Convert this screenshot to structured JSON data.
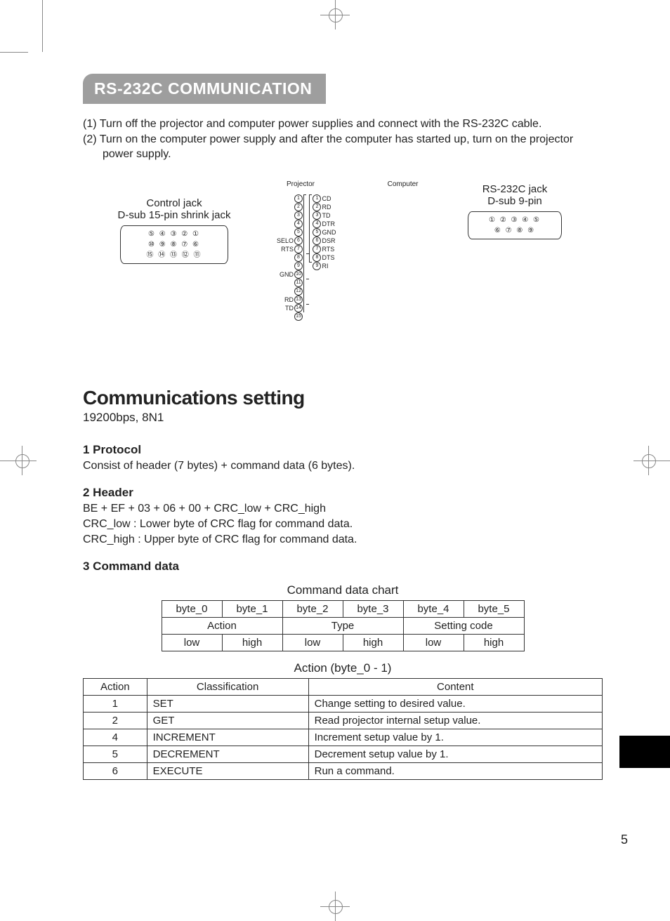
{
  "page_number": "5",
  "title": "RS-232C COMMUNICATION",
  "intro": {
    "line1": "(1) Turn off the projector and computer power supplies and connect with the RS-232C cable.",
    "line2": "(2) Turn on the computer power supply and after the computer has started up, turn on the projector power supply."
  },
  "diagrams": {
    "control": {
      "label1": "Control jack",
      "label2": "D-sub 15-pin shrink jack"
    },
    "projector_label": "Projector",
    "computer_label": "Computer",
    "rs232c": {
      "label1": "RS-232C jack",
      "label2": "D-sub 9-pin"
    },
    "projector_pins": [
      "1",
      "2",
      "3",
      "4",
      "5",
      "6",
      "7",
      "8",
      "9",
      "10",
      "11",
      "12",
      "13",
      "14",
      "15"
    ],
    "projector_signals": {
      "6": "SELO",
      "7": "RTS",
      "10": "GND",
      "13": "RD",
      "14": "TD"
    },
    "computer_pins": [
      "1",
      "2",
      "3",
      "4",
      "5",
      "6",
      "7",
      "8",
      "9"
    ],
    "computer_signals": {
      "1": "CD",
      "2": "RD",
      "3": "TD",
      "4": "DTR",
      "5": "GND",
      "6": "DSR",
      "7": "RTS",
      "8": "DTS",
      "9": "RI"
    }
  },
  "comm": {
    "heading": "Communications setting",
    "sub": "19200bps,  8N1",
    "s1h": "1 Protocol",
    "s1b": "Consist of header (7 bytes) + command data (6 bytes).",
    "s2h": "2 Header",
    "s2b1": "BE + EF + 03 + 06 + 00 + CRC_low + CRC_high",
    "s2b2": "CRC_low : Lower byte of CRC flag for command data.",
    "s2b3": "CRC_high : Upper byte of CRC flag for command data.",
    "s3h": "3 Command data"
  },
  "cmd_chart": {
    "title": "Command data chart",
    "h": [
      "byte_0",
      "byte_1",
      "byte_2",
      "byte_3",
      "byte_4",
      "byte_5"
    ],
    "g": [
      "Action",
      "Type",
      "Setting code"
    ],
    "lh": [
      "low",
      "high",
      "low",
      "high",
      "low",
      "high"
    ]
  },
  "action_table": {
    "title": "Action (byte_0 - 1)",
    "head": [
      "Action",
      "Classification",
      "Content"
    ],
    "rows": [
      {
        "a": "1",
        "c": "SET",
        "d": "Change setting to desired value."
      },
      {
        "a": "2",
        "c": "GET",
        "d": "Read projector internal setup value."
      },
      {
        "a": "4",
        "c": "INCREMENT",
        "d": "Increment setup value by 1."
      },
      {
        "a": "5",
        "c": "DECREMENT",
        "d": "Decrement setup value by 1."
      },
      {
        "a": "6",
        "c": "EXECUTE",
        "d": "Run a command."
      }
    ]
  },
  "chart_data": [
    {
      "type": "table",
      "title": "Command data chart",
      "columns": [
        "byte_0",
        "byte_1",
        "byte_2",
        "byte_3",
        "byte_4",
        "byte_5"
      ],
      "groups": [
        {
          "name": "Action",
          "bytes": [
            "byte_0",
            "byte_1"
          ],
          "order": [
            "low",
            "high"
          ]
        },
        {
          "name": "Type",
          "bytes": [
            "byte_2",
            "byte_3"
          ],
          "order": [
            "low",
            "high"
          ]
        },
        {
          "name": "Setting code",
          "bytes": [
            "byte_4",
            "byte_5"
          ],
          "order": [
            "low",
            "high"
          ]
        }
      ]
    },
    {
      "type": "table",
      "title": "Action (byte_0 - 1)",
      "columns": [
        "Action",
        "Classification",
        "Content"
      ],
      "rows": [
        [
          1,
          "SET",
          "Change setting to desired value."
        ],
        [
          2,
          "GET",
          "Read projector internal setup value."
        ],
        [
          4,
          "INCREMENT",
          "Increment setup value by 1."
        ],
        [
          5,
          "DECREMENT",
          "Decrement setup value by 1."
        ],
        [
          6,
          "EXECUTE",
          "Run a command."
        ]
      ]
    }
  ]
}
